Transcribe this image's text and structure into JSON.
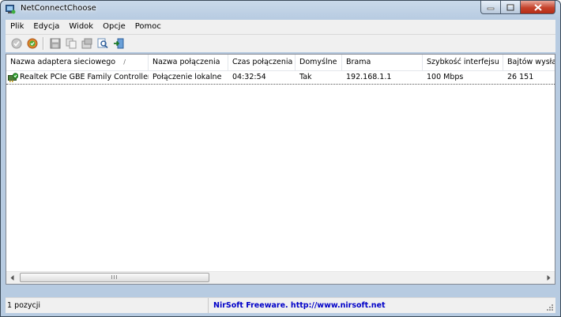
{
  "window": {
    "title": "NetConnectChoose"
  },
  "menu": [
    "Plik",
    "Edycja",
    "Widok",
    "Opcje",
    "Pomoc"
  ],
  "toolbar": {
    "buttons": [
      "check-disabled-icon",
      "check-active-icon",
      "save-icon",
      "copy-icon",
      "properties-icon",
      "find-icon",
      "exit-icon"
    ]
  },
  "columns": [
    "Nazwa adaptera sieciowego",
    "Nazwa połączenia",
    "Czas połączenia",
    "Domyślne",
    "Brama",
    "Szybkość interfejsu",
    "Bajtów wysłan"
  ],
  "sort_indicator": "/",
  "rows": [
    {
      "adapter": "Realtek PCIe GBE Family Controller",
      "connection": "Połączenie lokalne",
      "time": "04:32:54",
      "default": "Tak",
      "gateway": "192.168.1.1",
      "speed": "100 Mbps",
      "bytes_sent": "26 151"
    }
  ],
  "scrollbar": {
    "grip": "III"
  },
  "status": {
    "count": "1 pozycji",
    "link": "NirSoft Freeware.  http://www.nirsoft.net"
  },
  "colors": {
    "title_bar": "#b7cbe1",
    "link": "#0000c8",
    "close_button": "#c5432c"
  }
}
